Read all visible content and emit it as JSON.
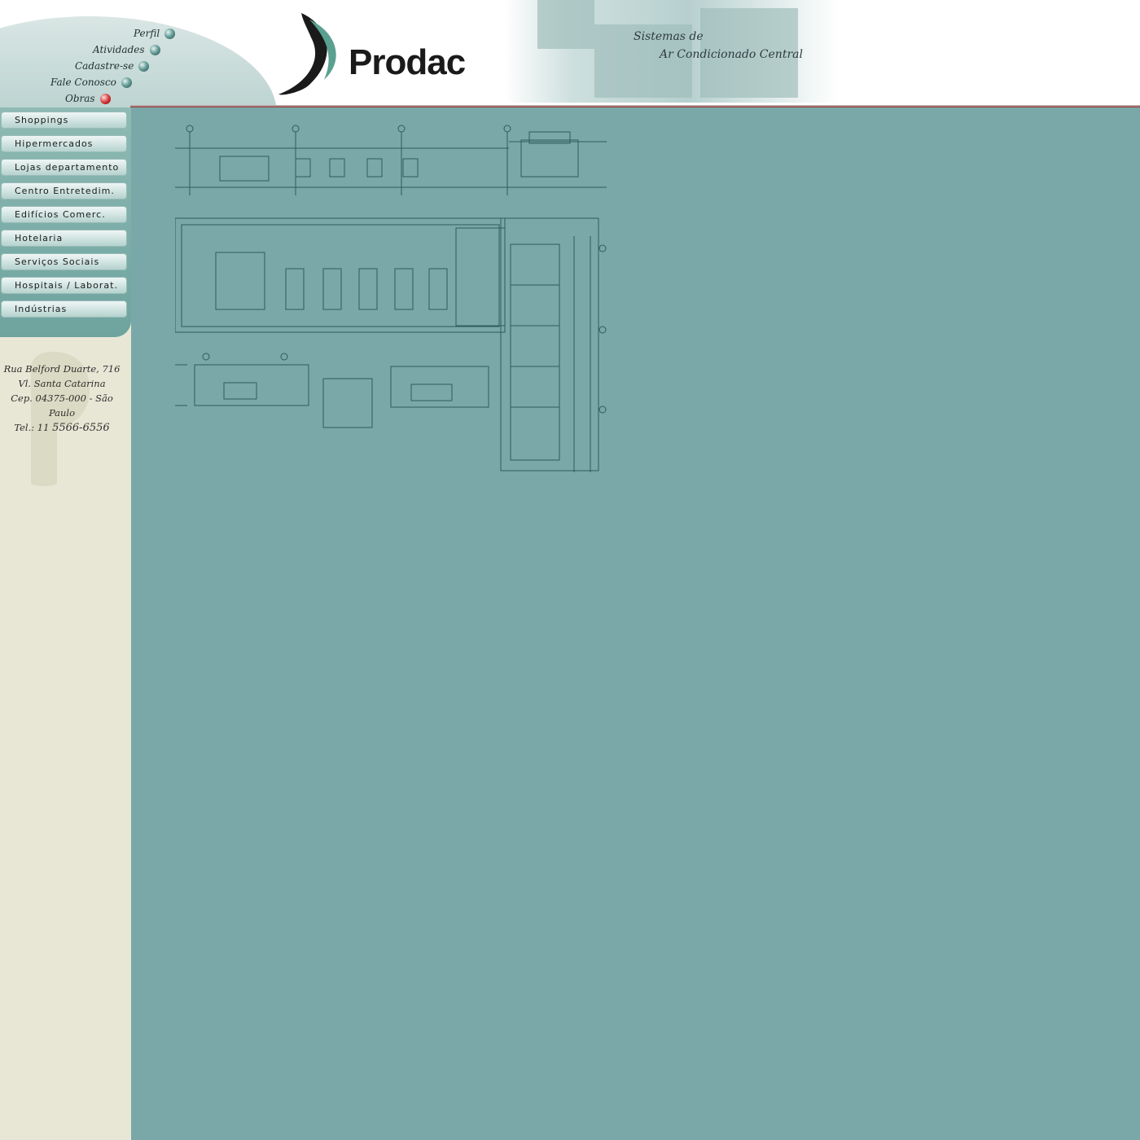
{
  "top_menu": {
    "items": [
      {
        "label": "Perfil"
      },
      {
        "label": "Atividades"
      },
      {
        "label": "Cadastre-se"
      },
      {
        "label": "Fale Conosco"
      },
      {
        "label": "Obras"
      }
    ]
  },
  "logo": {
    "text": "Prodac"
  },
  "tagline": {
    "line1": "Sistemas de",
    "line2": "Ar Condicionado Central"
  },
  "categories": [
    {
      "label": "Shoppings"
    },
    {
      "label": "Hipermercados"
    },
    {
      "label": "Lojas departamento"
    },
    {
      "label": "Centro Entretedim."
    },
    {
      "label": "Edifícios Comerc."
    },
    {
      "label": "Hotelaria"
    },
    {
      "label": "Serviços Sociais"
    },
    {
      "label": "Hospitais / Laborat."
    },
    {
      "label": "Indústrias"
    }
  ],
  "address": {
    "street": "Rua Belford Duarte, 716",
    "district": "Vl. Santa Catarina",
    "city": "Cep. 04375-000 - São Paulo",
    "phone_prefix": "Tel.: 11",
    "phone": "5566-6556"
  },
  "colors": {
    "background": "#7aa8a8",
    "sidebar": "#e8e7d6",
    "accent_red": "#8a2a2a",
    "brand_green": "#5aa090"
  },
  "icons": {
    "top_menu_bullet": "teal-orb-icon",
    "obras_bullet": "red-down-arrow-icon"
  }
}
